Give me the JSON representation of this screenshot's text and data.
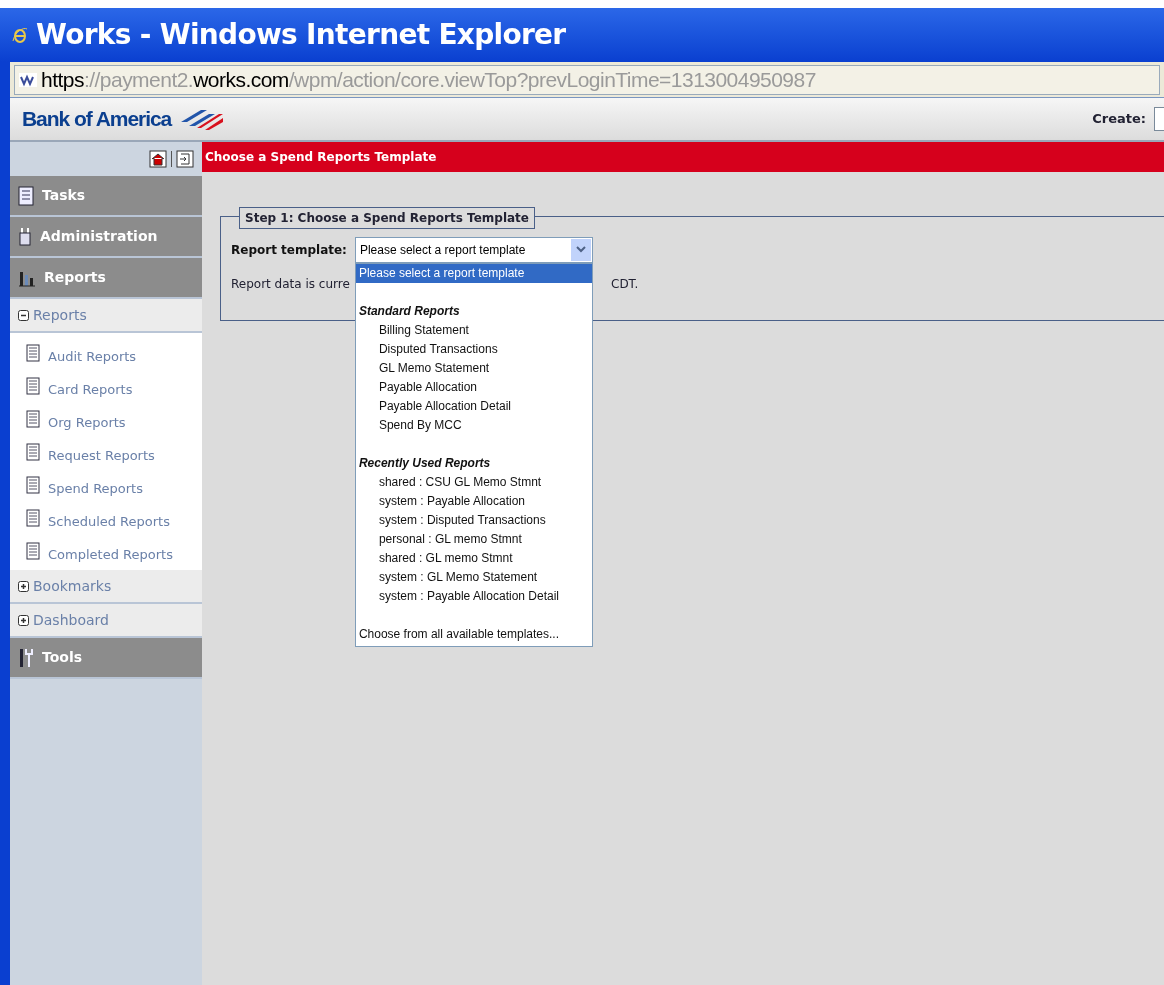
{
  "window": {
    "title": "Works - Windows Internet Explorer"
  },
  "address_bar": {
    "parts": [
      {
        "text": "https",
        "emphasis": true
      },
      {
        "text": "://payment2.",
        "emphasis": false
      },
      {
        "text": "works.com",
        "emphasis": true
      },
      {
        "text": "/wpm/action/core.viewTop?prevLoginTime=1313004950987",
        "emphasis": false
      }
    ]
  },
  "header": {
    "logo": "Bank of America",
    "create_label": "Create:"
  },
  "sidebar": {
    "sections": [
      {
        "label": "Tasks",
        "kind": "header"
      },
      {
        "label": "Administration",
        "kind": "header"
      },
      {
        "label": "Reports",
        "kind": "header"
      },
      {
        "label": "Reports",
        "kind": "group",
        "expanded": true,
        "children": [
          {
            "label": "Audit Reports"
          },
          {
            "label": "Card Reports"
          },
          {
            "label": "Org Reports"
          },
          {
            "label": "Request Reports"
          },
          {
            "label": "Spend Reports"
          },
          {
            "label": "Scheduled Reports"
          },
          {
            "label": "Completed Reports"
          }
        ]
      },
      {
        "label": "Bookmarks",
        "kind": "group",
        "expanded": false
      },
      {
        "label": "Dashboard",
        "kind": "group",
        "expanded": false
      },
      {
        "label": "Tools",
        "kind": "header"
      }
    ]
  },
  "page_title": "Choose a Spend Reports Template",
  "step": {
    "legend": "Step 1: Choose a Spend Reports Template",
    "field_label": "Report template:",
    "select_value": "Please select a report template",
    "note_start": "Report data is curre",
    "note_end": "CDT."
  },
  "dropdown": {
    "options": [
      {
        "kind": "option",
        "label": "Please select a report template",
        "selected": true
      },
      {
        "kind": "gap"
      },
      {
        "kind": "heading",
        "label": "Standard Reports"
      },
      {
        "kind": "item",
        "label": "Billing Statement",
        "selected": false
      },
      {
        "kind": "item",
        "label": "Disputed Transactions",
        "selected": false
      },
      {
        "kind": "item",
        "label": "GL Memo Statement",
        "selected": false
      },
      {
        "kind": "item",
        "label": "Payable Allocation",
        "selected": false
      },
      {
        "kind": "item",
        "label": "Payable Allocation Detail",
        "selected": false
      },
      {
        "kind": "item",
        "label": "Spend By MCC",
        "selected": false
      },
      {
        "kind": "gap"
      },
      {
        "kind": "heading",
        "label": "Recently Used Reports"
      },
      {
        "kind": "item",
        "label": "shared : CSU GL Memo Stmnt",
        "selected": false
      },
      {
        "kind": "item",
        "label": "system : Payable Allocation",
        "selected": false
      },
      {
        "kind": "item",
        "label": "system : Disputed Transactions",
        "selected": false
      },
      {
        "kind": "item",
        "label": "personal : GL memo Stmnt",
        "selected": false
      },
      {
        "kind": "item",
        "label": "shared : GL memo Stmnt",
        "selected": false
      },
      {
        "kind": "item",
        "label": "system : GL Memo Statement",
        "selected": false
      },
      {
        "kind": "item",
        "label": "system : Payable Allocation Detail",
        "selected": false
      },
      {
        "kind": "gap"
      },
      {
        "kind": "option",
        "label": "Choose from all available templates...",
        "selected": false
      }
    ]
  }
}
